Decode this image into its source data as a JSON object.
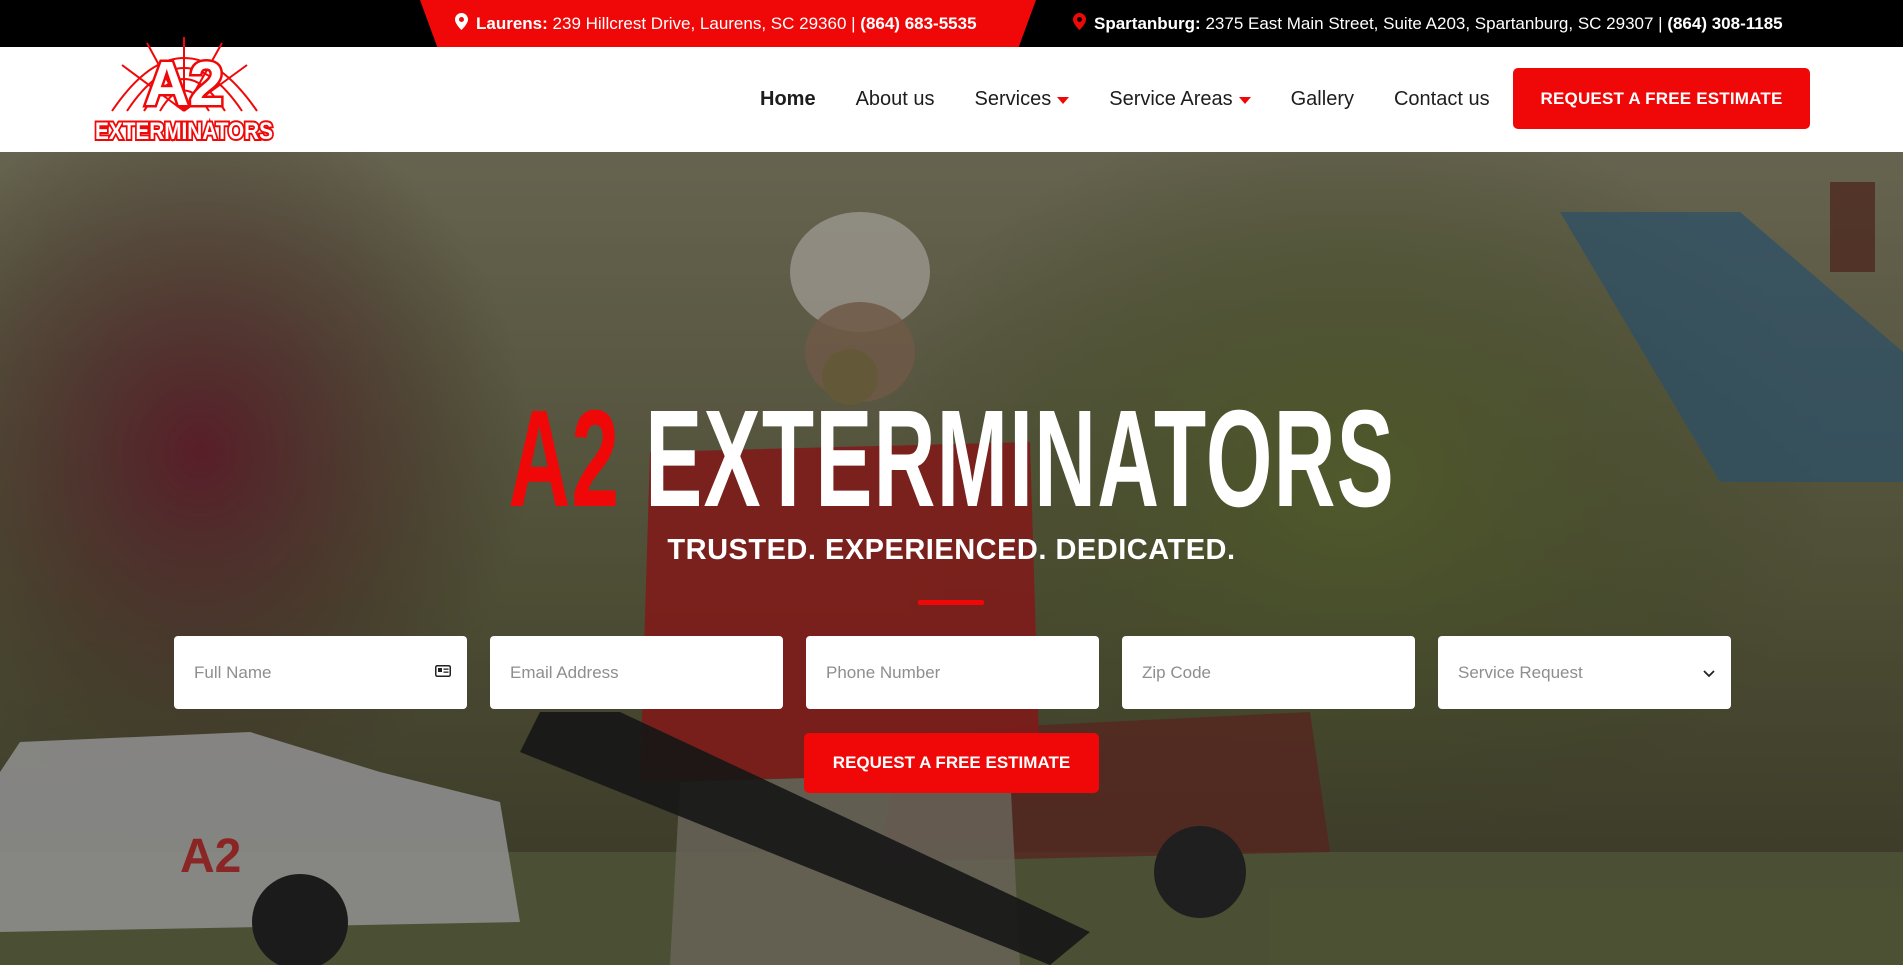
{
  "topbar": {
    "laurens": {
      "city": "Laurens:",
      "address": "239 Hillcrest Drive, Laurens, SC 29360 |",
      "phone": "(864) 683-5535"
    },
    "spartanburg": {
      "city": "Spartanburg:",
      "address": "2375 East Main Street, Suite A203, Spartanburg, SC 29307 |",
      "phone": "(864) 308-1185"
    },
    "pin_icon": "map-pin-icon"
  },
  "logo": {
    "line1": "A2",
    "line2": "EXTERMINATORS"
  },
  "nav": {
    "items": [
      {
        "label": "Home",
        "active": true
      },
      {
        "label": "About us"
      },
      {
        "label": "Services",
        "dropdown": true
      },
      {
        "label": "Service Areas",
        "dropdown": true
      },
      {
        "label": "Gallery"
      },
      {
        "label": "Contact us"
      }
    ],
    "cta": "REQUEST A FREE ESTIMATE"
  },
  "hero": {
    "brand_red": "A2",
    "brand_white": "EXTERMINATORS",
    "tagline": "TRUSTED. EXPERIENCED. DEDICATED.",
    "form": {
      "full_name": "Full Name",
      "email": "Email Address",
      "phone": "Phone Number",
      "zip": "Zip Code",
      "service": "Service Request"
    },
    "cta": "REQUEST A FREE ESTIMATE"
  },
  "colors": {
    "accent": "#f00808",
    "dark": "#000000",
    "text": "#1d1d1d"
  }
}
